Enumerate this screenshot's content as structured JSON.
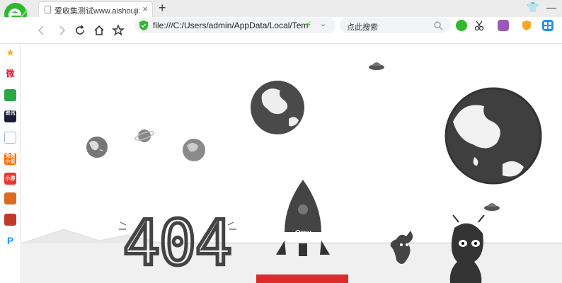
{
  "browser": {
    "tab": {
      "title": "爱收集测试www.aishoujizy.com",
      "close": "×"
    },
    "new_tab": "+",
    "window_controls": {
      "shirt": "👕",
      "min": "—",
      "max": "▢",
      "close": "×"
    },
    "address": {
      "url": "file:///C:/Users/admin/AppData/Local/Tem",
      "bolt": "⚡",
      "chevron": "⌄"
    },
    "search": {
      "placeholder": "点此搜索"
    }
  },
  "sidebar": {
    "items": [
      {
        "name": "favorites-star",
        "color": "#f5a623",
        "text": "★"
      },
      {
        "name": "weibo",
        "color": "#e6162d",
        "text": "微"
      },
      {
        "name": "mail",
        "color": "#2ca745",
        "text": ""
      },
      {
        "name": "news",
        "color": "#1a1a3a",
        "text": "资讯"
      },
      {
        "name": "document",
        "color": "#ffffff",
        "text": ""
      },
      {
        "name": "free-novel",
        "color": "#ff6a00",
        "text": "免费小说"
      },
      {
        "name": "mini-game",
        "color": "#e8382f",
        "text": "小游"
      },
      {
        "name": "game-1",
        "color": "#d86b1e",
        "text": ""
      },
      {
        "name": "game-2",
        "color": "#c0392b",
        "text": ""
      },
      {
        "name": "pp-assistant",
        "color": "#1e90ff",
        "text": "P"
      }
    ]
  },
  "page": {
    "error_code": "404",
    "rocket_label": "Oray"
  },
  "colors": {
    "accent_green": "#2eb82e",
    "planet": "#4a4a4a",
    "red_button": "#dc2b2b"
  }
}
